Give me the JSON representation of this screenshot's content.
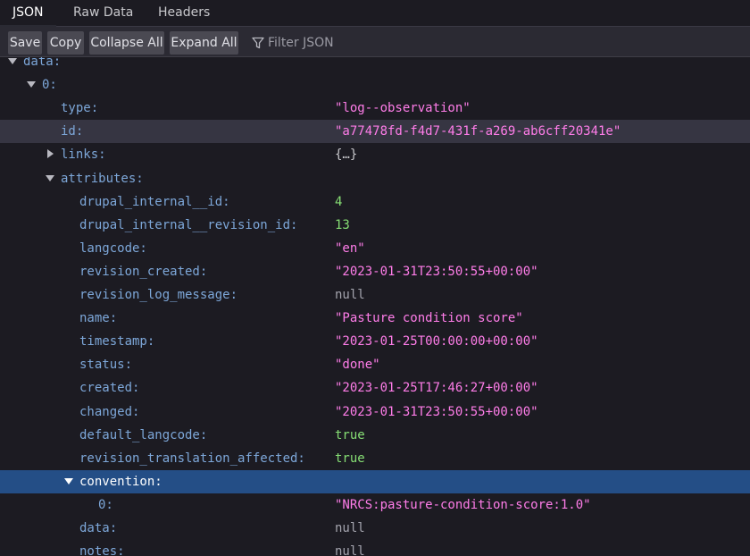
{
  "tabs": [
    {
      "label": "JSON"
    },
    {
      "label": "Raw Data"
    },
    {
      "label": "Headers"
    }
  ],
  "toolbar": {
    "save": "Save",
    "copy": "Copy",
    "collapse_all": "Collapse All",
    "expand_all": "Expand All",
    "filter_placeholder": "Filter JSON"
  },
  "rows": [
    {
      "key": "data:",
      "value": "",
      "type": "",
      "indent": 0,
      "toggle": "down"
    },
    {
      "key": "0:",
      "value": "",
      "type": "",
      "indent": 1,
      "toggle": "down"
    },
    {
      "key": "type:",
      "value": "\"log--observation\"",
      "type": "str",
      "indent": 2,
      "toggle": ""
    },
    {
      "key": "id:",
      "value": "\"a77478fd-f4d7-431f-a269-ab6cff20341e\"",
      "type": "str",
      "indent": 2,
      "toggle": "",
      "state": "hl"
    },
    {
      "key": "links:",
      "value": "{…}",
      "type": "obj",
      "indent": 2,
      "toggle": "right"
    },
    {
      "key": "attributes:",
      "value": "",
      "type": "",
      "indent": 2,
      "toggle": "down"
    },
    {
      "key": "drupal_internal__id:",
      "value": "4",
      "type": "num",
      "indent": 3,
      "toggle": ""
    },
    {
      "key": "drupal_internal__revision_id:",
      "value": "13",
      "type": "num",
      "indent": 3,
      "toggle": ""
    },
    {
      "key": "langcode:",
      "value": "\"en\"",
      "type": "str",
      "indent": 3,
      "toggle": ""
    },
    {
      "key": "revision_created:",
      "value": "\"2023-01-31T23:50:55+00:00\"",
      "type": "str",
      "indent": 3,
      "toggle": ""
    },
    {
      "key": "revision_log_message:",
      "value": "null",
      "type": "null",
      "indent": 3,
      "toggle": ""
    },
    {
      "key": "name:",
      "value": "\"Pasture condition score\"",
      "type": "str",
      "indent": 3,
      "toggle": ""
    },
    {
      "key": "timestamp:",
      "value": "\"2023-01-25T00:00:00+00:00\"",
      "type": "str",
      "indent": 3,
      "toggle": ""
    },
    {
      "key": "status:",
      "value": "\"done\"",
      "type": "str",
      "indent": 3,
      "toggle": ""
    },
    {
      "key": "created:",
      "value": "\"2023-01-25T17:46:27+00:00\"",
      "type": "str",
      "indent": 3,
      "toggle": ""
    },
    {
      "key": "changed:",
      "value": "\"2023-01-31T23:50:55+00:00\"",
      "type": "str",
      "indent": 3,
      "toggle": ""
    },
    {
      "key": "default_langcode:",
      "value": "true",
      "type": "bool",
      "indent": 3,
      "toggle": ""
    },
    {
      "key": "revision_translation_affected:",
      "value": "true",
      "type": "bool",
      "indent": 3,
      "toggle": ""
    },
    {
      "key": "convention:",
      "value": "",
      "type": "",
      "indent": 3,
      "toggle": "down",
      "state": "sel"
    },
    {
      "key": "0:",
      "value": "\"NRCS:pasture-condition-score:1.0\"",
      "type": "str",
      "indent": 4,
      "toggle": ""
    },
    {
      "key": "data:",
      "value": "null",
      "type": "null",
      "indent": 3,
      "toggle": ""
    },
    {
      "key": "notes:",
      "value": "null",
      "type": "null",
      "indent": 3,
      "toggle": ""
    }
  ]
}
